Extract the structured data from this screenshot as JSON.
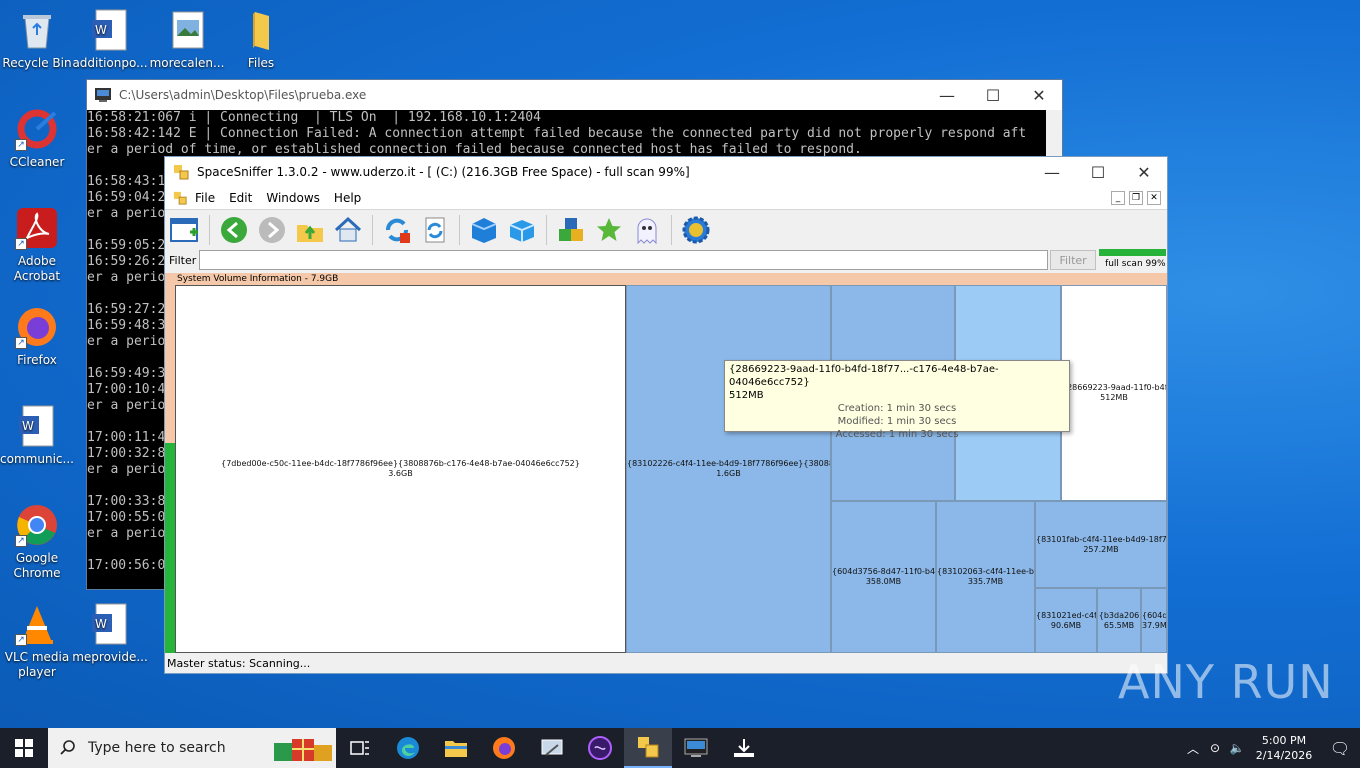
{
  "desktop_icons": [
    {
      "label": "Recycle Bin"
    },
    {
      "label": "additionpo..."
    },
    {
      "label": "morecalen..."
    },
    {
      "label": "Files"
    },
    {
      "label": "CCleaner"
    },
    {
      "label": "Adobe Acrobat"
    },
    {
      "label": "Firefox"
    },
    {
      "label": "communic..."
    },
    {
      "label": "Google Chrome"
    },
    {
      "label": "VLC media player"
    },
    {
      "label": "meprovide..."
    }
  ],
  "console": {
    "title": "C:\\Users\\admin\\Desktop\\Files\\prueba.exe",
    "text": "16:58:21:067 i | Connecting  | TLS On  | 192.168.10.1:2404\n16:58:42:142 E | Connection Failed: A connection attempt failed because the connected party did not properly respond aft\ner a period of time, or established connection failed because connected host has failed to respond.\n\n16:58:43:1\n16:59:04:2\ner a perio\n\n16:59:05:2\n16:59:26:2\ner a perio\n\n16:59:27:2\n16:59:48:3\ner a perio\n\n16:59:49:3\n17:00:10:4\ner a perio\n\n17:00:11:4\n17:00:32:8\ner a perio\n\n17:00:33:8\n17:00:55:0\ner a perio\n\n17:00:56:0"
  },
  "spacesniffer": {
    "title": "SpaceSniffer 1.3.0.2 - www.uderzo.it - [ (C:) (216.3GB Free Space) - full scan 99%]",
    "menu": [
      "File",
      "Edit",
      "Windows",
      "Help"
    ],
    "filter_label": "Filter",
    "filter_value": "",
    "filter_button": "Filter",
    "progress_text": "full scan 99%",
    "progress_fraction": 0.99,
    "header": "System Volume Information - 7.9GB",
    "cells": [
      {
        "name": "{7dbed00e-c50c-11ee-b4dc-18f7786f96ee}{3808876b-c176-4e48-b7ae-04046e6cc752}",
        "size": "3.6GB"
      },
      {
        "name": "{83102226-c4f4-11ee-b4d9-18f7786f96ee}{38088",
        "size": "1.6GB"
      },
      {
        "name": "{28669223-9aad-11f0-b4f",
        "size": "512MB"
      },
      {
        "name": "{604d3756-8d47-11f0-b4",
        "size": "358.0MB"
      },
      {
        "name": "{83102063-c4f4-11ee-b",
        "size": "335.7MB"
      },
      {
        "name": "{83101fab-c4f4-11ee-b4d9-18f7",
        "size": "257.2MB"
      },
      {
        "name": "{831021ed-c4f",
        "size": "90.6MB"
      },
      {
        "name": "{b3da206",
        "size": "65.5MB"
      },
      {
        "name": "{604d",
        "size": "37.9M"
      }
    ],
    "tooltip": {
      "name": "{28669223-9aad-11f0-b4fd-18f77...-c176-4e48-b7ae-04046e6cc752}",
      "size": "512MB",
      "creation": "Creation: 1 min 30 secs",
      "modified": "Modified: 1 min 30 secs",
      "accessed": "Accessed: 1 min 30 secs"
    },
    "status": "Master status: Scanning..."
  },
  "taskbar": {
    "search_placeholder": "Type here to search",
    "time": "5:00 PM",
    "date": "2/14/2026"
  },
  "watermark": "ANY RUN"
}
